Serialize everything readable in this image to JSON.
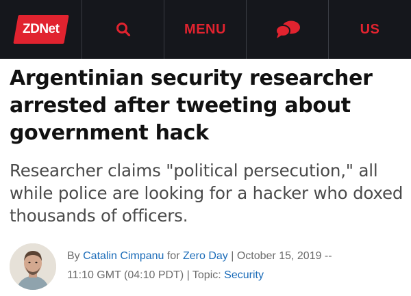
{
  "header": {
    "logo_text": "ZDNet",
    "logo_icon": "zdnet-logo",
    "search_icon": "search-icon",
    "menu_label": "MENU",
    "chat_icon": "chat-bubbles-icon",
    "region_label": "US",
    "accent_color": "#e1232f",
    "background_color": "#15171c"
  },
  "article": {
    "headline": "Argentinian security researcher arrested after tweeting about government hack",
    "deck": "Researcher claims \"political persecution,\" all while police are looking for a hacker who doxed thousands of officers.",
    "byline": {
      "by": "By",
      "author": "Catalin Cimpanu",
      "for": "for",
      "blog": "Zero Day",
      "sep1": "|",
      "date": "October 15, 2019 --",
      "time": "11:10 GMT (04:10 PDT)",
      "sep2": "|",
      "topic_label": "Topic:",
      "topic": "Security",
      "link_color": "#1a6bb8"
    },
    "avatar_icon": "author-avatar"
  }
}
